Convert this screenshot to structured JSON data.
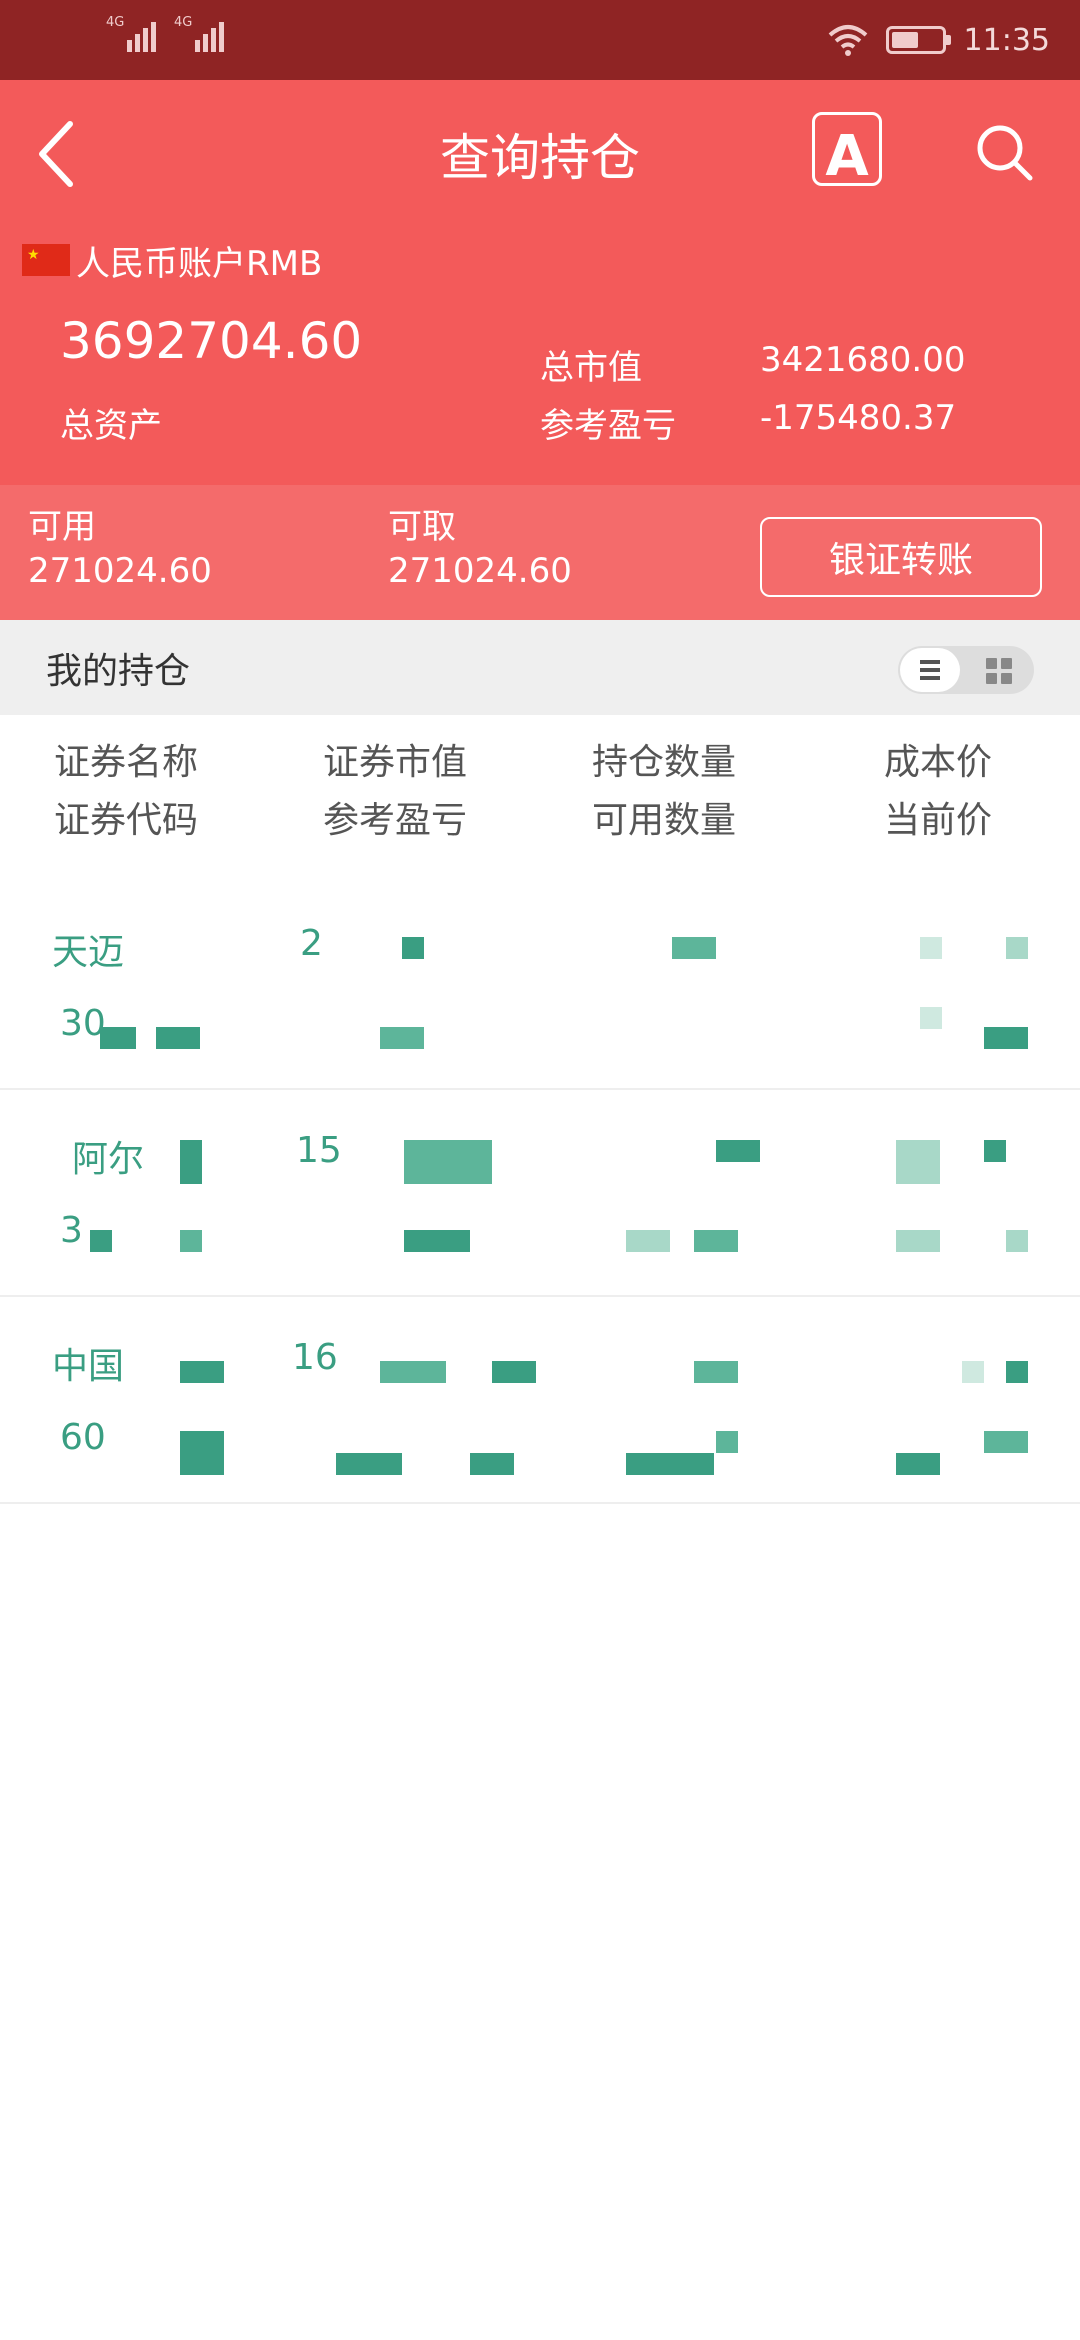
{
  "status_bar": {
    "signal1_label": "4G",
    "signal2_label": "4G",
    "time": "11:35",
    "battery_level": 0.55,
    "icons": [
      "signal-icon",
      "wifi-icon",
      "battery-icon"
    ]
  },
  "header": {
    "title": "查询持仓",
    "font_button_label": "A",
    "account_label": "人民币账户RMB",
    "total_assets_value": "3692704.60",
    "total_assets_label": "总资产",
    "market_value_label": "总市值",
    "market_value": "3421680.00",
    "pnl_label": "参考盈亏",
    "pnl_value": "-175480.37"
  },
  "funds": {
    "available_label": "可用",
    "available_value": "271024.60",
    "withdrawable_label": "可取",
    "withdrawable_value": "271024.60",
    "transfer_button": "银证转账"
  },
  "holdings_section": {
    "title": "我的持仓"
  },
  "columns": {
    "name": "证券名称",
    "code": "证券代码",
    "market_value": "证券市值",
    "pnl": "参考盈亏",
    "position_qty": "持仓数量",
    "available_qty": "可用数量",
    "cost_price": "成本价",
    "current_price": "当前价"
  },
  "holdings": [
    {
      "name": "天迈",
      "code": "30",
      "market_value": "2"
    },
    {
      "name": "阿尔",
      "code": "3",
      "market_value": "15"
    },
    {
      "name": "中国",
      "code": "60",
      "market_value": "16"
    }
  ],
  "colors": {
    "status_bar": "#8f2424",
    "header": "#f35a5a",
    "funds_band": "#f46b6b",
    "holding_text": "#3a9e82"
  }
}
